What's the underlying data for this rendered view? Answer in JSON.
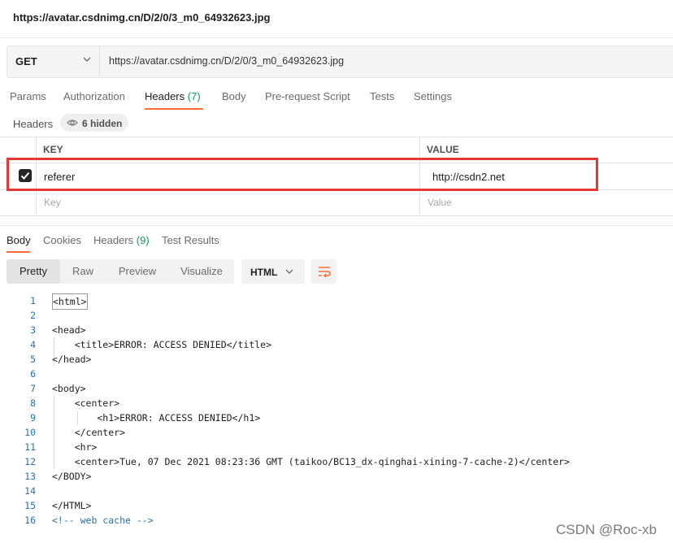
{
  "window": {
    "title": "https://avatar.csdnimg.cn/D/2/0/3_m0_64932623.jpg"
  },
  "request": {
    "method": "GET",
    "url": "https://avatar.csdnimg.cn/D/2/0/3_m0_64932623.jpg"
  },
  "request_tabs": [
    {
      "label": "Params"
    },
    {
      "label": "Authorization"
    },
    {
      "label": "Headers",
      "count": "(7)",
      "active": true
    },
    {
      "label": "Body"
    },
    {
      "label": "Pre-request Script"
    },
    {
      "label": "Tests"
    },
    {
      "label": "Settings"
    }
  ],
  "headers_section": {
    "label": "Headers",
    "hidden": "6 hidden",
    "columns": {
      "key": "KEY",
      "value": "VALUE"
    },
    "rows": [
      {
        "key": "referer",
        "value": "http://csdn2.net",
        "checked": true
      }
    ],
    "placeholder": {
      "key": "Key",
      "value": "Value"
    }
  },
  "response_tabs": [
    {
      "label": "Body",
      "active": true
    },
    {
      "label": "Cookies"
    },
    {
      "label": "Headers",
      "count": "(9)"
    },
    {
      "label": "Test Results"
    }
  ],
  "view_modes": [
    "Pretty",
    "Raw",
    "Preview",
    "Visualize"
  ],
  "active_view": "Pretty",
  "format": "HTML",
  "code_lines": [
    {
      "n": "1",
      "text": "<html>"
    },
    {
      "n": "2",
      "text": ""
    },
    {
      "n": "3",
      "text": "<head>"
    },
    {
      "n": "4",
      "text": "    <title>ERROR: ACCESS DENIED</title>"
    },
    {
      "n": "5",
      "text": "</head>"
    },
    {
      "n": "6",
      "text": ""
    },
    {
      "n": "7",
      "text": "<body>"
    },
    {
      "n": "8",
      "text": "    <center>"
    },
    {
      "n": "9",
      "text": "        <h1>ERROR: ACCESS DENIED</h1>"
    },
    {
      "n": "10",
      "text": "    </center>"
    },
    {
      "n": "11",
      "text": "    <hr>"
    },
    {
      "n": "12",
      "text": "    <center>Tue, 07 Dec 2021 08:23:36 GMT (taikoo/BC13_dx-qinghai-xining-7-cache-2)</center>"
    },
    {
      "n": "13",
      "text": "</BODY>"
    },
    {
      "n": "14",
      "text": ""
    },
    {
      "n": "15",
      "text": "</HTML>"
    },
    {
      "n": "16",
      "text": "<!-- web cache -->",
      "comment": true
    }
  ],
  "watermark": "CSDN @Roc-xb",
  "icons": {
    "method_dropdown": "chevron-down-icon",
    "hidden_toggle": "eye-icon",
    "checkbox": "checkmark-icon",
    "format_dropdown": "chevron-down-icon",
    "wrap": "wrap-lines-icon"
  },
  "colors": {
    "accent": "#ff6c37",
    "count_green": "#0f9d58",
    "highlight_box": "#e53935",
    "line_numbers": "#2f6fa8"
  }
}
